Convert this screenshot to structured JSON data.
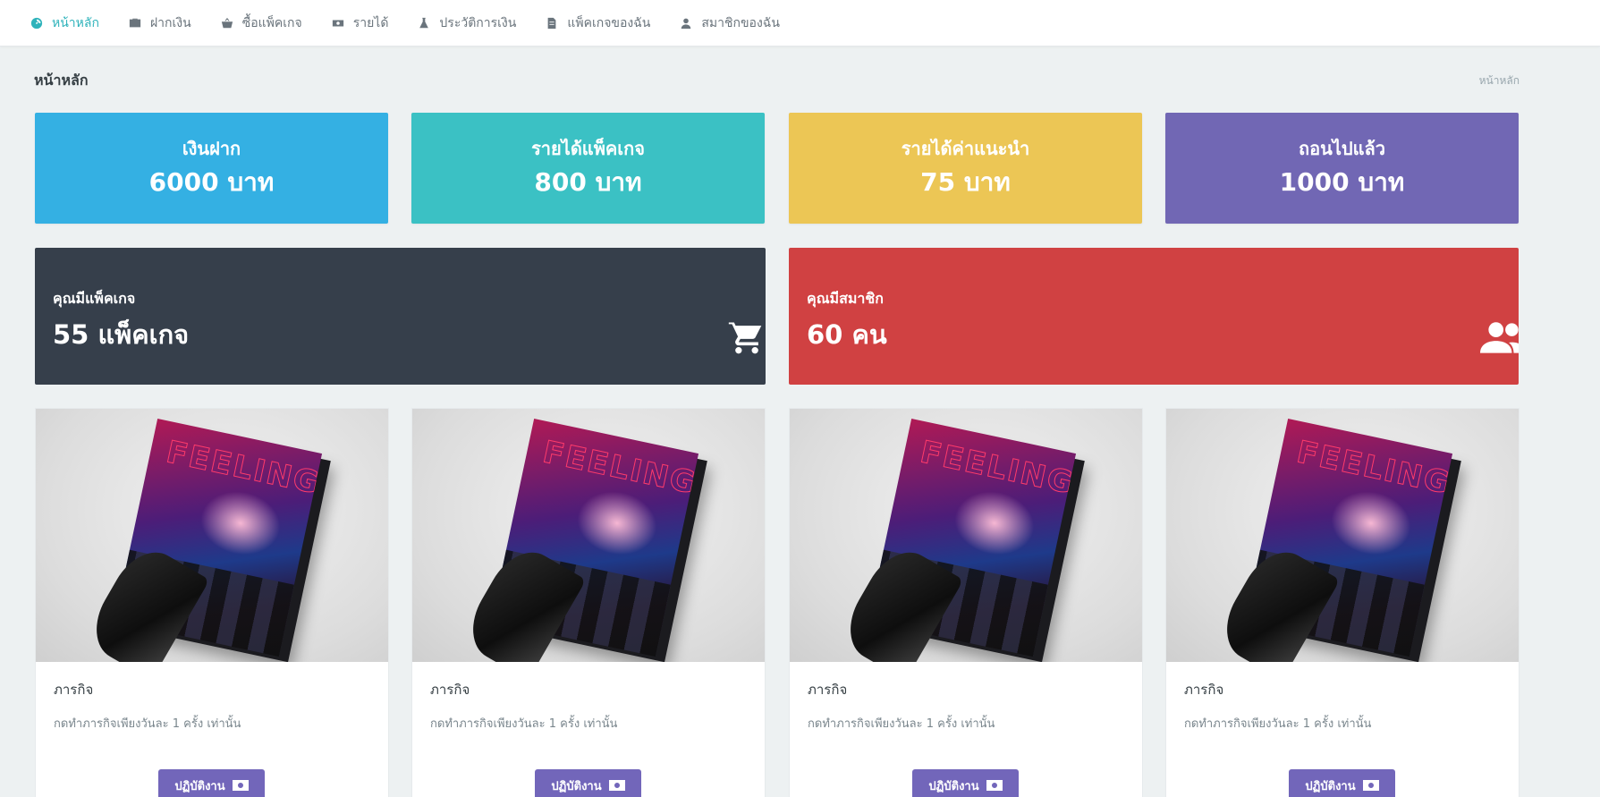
{
  "nav": {
    "items": [
      {
        "label": "หน้าหลัก",
        "icon": "dashboard-icon",
        "active": true
      },
      {
        "label": "ฝากเงิน",
        "icon": "briefcase-icon",
        "active": false
      },
      {
        "label": "ซื้อแพ็คเกจ",
        "icon": "basket-icon",
        "active": false
      },
      {
        "label": "รายได้",
        "icon": "money-icon",
        "active": false
      },
      {
        "label": "ประวัติการเงิน",
        "icon": "flask-icon",
        "active": false
      },
      {
        "label": "แพ็คเกจของฉัน",
        "icon": "document-icon",
        "active": false
      },
      {
        "label": "สมาชิกของฉัน",
        "icon": "user-icon",
        "active": false
      }
    ]
  },
  "page": {
    "title": "หน้าหลัก",
    "breadcrumb": "หน้าหลัก"
  },
  "stats": [
    {
      "label": "เงินฝาก",
      "value": "6000 บาท",
      "color": "#34b0e3"
    },
    {
      "label": "รายได้แพ็คเกจ",
      "value": "800 บาท",
      "color": "#3bc1c4"
    },
    {
      "label": "รายได้ค่าแนะนำ",
      "value": "75 บาท",
      "color": "#ecc655"
    },
    {
      "label": "ถอนไปแล้ว",
      "value": "1000 บาท",
      "color": "#7167b4"
    }
  ],
  "panels": {
    "packages": {
      "label": "คุณมีแพ็คเกจ",
      "value": "55 แพ็คเกจ",
      "icon": "cart-icon",
      "color": "#363f4b"
    },
    "members": {
      "label": "คุณมีสมาชิก",
      "value": "60 คน",
      "icon": "group-icon",
      "color": "#d04142"
    }
  },
  "cards": [
    {
      "title": "ภารกิจ",
      "desc": "กดทำภารกิจเพียงวันละ 1 ครั้ง เท่านั้น",
      "button": "ปฏิบัติงาน"
    },
    {
      "title": "ภารกิจ",
      "desc": "กดทำภารกิจเพียงวันละ 1 ครั้ง เท่านั้น",
      "button": "ปฏิบัติงาน"
    },
    {
      "title": "ภารกิจ",
      "desc": "กดทำภารกิจเพียงวันละ 1 ครั้ง เท่านั้น",
      "button": "ปฏิบัติงาน"
    },
    {
      "title": "ภารกิจ",
      "desc": "กดทำภารกิจเพียงวันละ 1 ครั้ง เท่านั้น",
      "button": "ปฏิบัติงาน"
    }
  ],
  "colors": {
    "accent": "#2fb3bb",
    "button": "#7266ba",
    "background": "#edf1f2"
  }
}
